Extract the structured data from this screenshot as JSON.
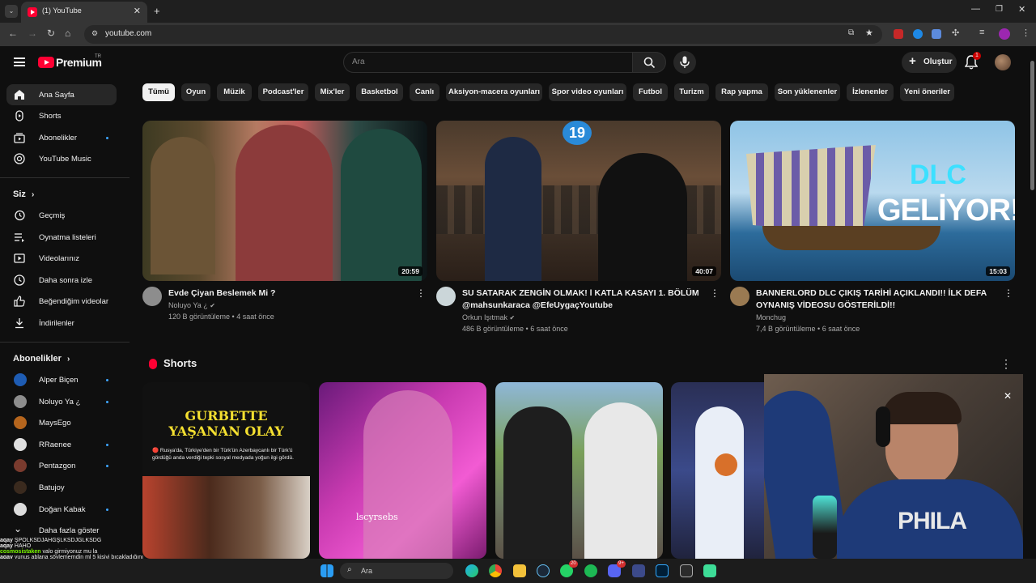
{
  "browser": {
    "tab_title": "(1) YouTube",
    "url": "youtube.com"
  },
  "header": {
    "logo_text": "Premium",
    "logo_sup": "TR",
    "search_placeholder": "Ara",
    "create_label": "Oluştur",
    "notification_count": "1"
  },
  "sidebar": {
    "main": [
      {
        "label": "Ana Sayfa",
        "icon": "home-icon"
      },
      {
        "label": "Shorts",
        "icon": "shorts-icon"
      },
      {
        "label": "Abonelikler",
        "icon": "subscriptions-icon"
      },
      {
        "label": "YouTube Music",
        "icon": "music-icon"
      }
    ],
    "you_header": "Siz",
    "you": [
      {
        "label": "Geçmiş"
      },
      {
        "label": "Oynatma listeleri"
      },
      {
        "label": "Videolarınız"
      },
      {
        "label": "Daha sonra izle"
      },
      {
        "label": "Beğendiğim videolar"
      },
      {
        "label": "İndirilenler"
      }
    ],
    "subs_header": "Abonelikler",
    "subs": [
      {
        "label": "Alper Biçen"
      },
      {
        "label": "Noluyo Ya ¿"
      },
      {
        "label": "MaysEgo"
      },
      {
        "label": "RRaenee"
      },
      {
        "label": "Pentazgon"
      },
      {
        "label": "Batujoy"
      },
      {
        "label": "Doğan Kabak"
      },
      {
        "label": "Daha fazla göster"
      }
    ]
  },
  "chips": [
    "Tümü",
    "Oyun",
    "Müzik",
    "Podcast'ler",
    "Mix'ler",
    "Basketbol",
    "Canlı",
    "Aksiyon-macera oyunları",
    "Spor video oyunları",
    "Futbol",
    "Turizm",
    "Rap yapma",
    "Son yüklenenler",
    "İzlenenler",
    "Yeni öneriler"
  ],
  "videos": [
    {
      "title": "Evde Çiyan Beslemek Mi ?",
      "channel": "Noluyo Ya ¿",
      "stats": "120 B görüntüleme • 4 saat önce",
      "duration": "20:59"
    },
    {
      "title": "SU SATARAK ZENGİN OLMAK! l KATLA KASAYI 1. BÖLÜM @mahsunkaraca @EfeUygaçYoutube",
      "channel": "Orkun Işıtmak",
      "stats": "486 B görüntüleme • 6 saat önce",
      "duration": "40:07"
    },
    {
      "title": "BANNERLORD DLC ÇIKIŞ TARİHİ AÇIKLANDI!! İLK DEFA OYNANIŞ VİDEOSU GÖSTERİLDİ!!",
      "channel": "Monchug",
      "stats": "7,4 B görüntüleme • 6 saat önce",
      "duration": "15:03"
    }
  ],
  "thumb_text": {
    "v2_badge": "19",
    "v3_line1": "DLC",
    "v3_line2": "GELİYOR!"
  },
  "shorts": {
    "title": "Shorts",
    "items": [
      {
        "overlay_title": "GURBETTE YAŞANAN OLAY",
        "overlay_text": "🔴 Rusya'da, Türkiye'den bir Türk'ün Azerbaycanlı bir Türk'ü gördüğü anda verdiği tepki sosyal medyada yoğun ilgi gördü."
      },
      {
        "overlay_text": "lscyrsebs"
      },
      {
        "overlay_text": ""
      },
      {
        "overlay_text": ""
      }
    ]
  },
  "chat": [
    {
      "user": "aqay",
      "text": "ŞPOLKSDJAHGŞLKSDJGLKSDG"
    },
    {
      "user": "aqay",
      "text": "HAHO"
    },
    {
      "user": "cosmosistaken",
      "text": "valo girmiyonuz mu la"
    },
    {
      "user": "aqay",
      "text": "yunus ablana söylemerndin ml 5 kişiyi bıçakladığını"
    }
  ],
  "taskbar": {
    "search_label": "Ara",
    "whatsapp_badge": "20",
    "discord_badge": "9+"
  },
  "colors": {
    "brand_red": "#ff0033",
    "accent_blue": "#3ea6ff",
    "bg": "#0f0f0f"
  }
}
